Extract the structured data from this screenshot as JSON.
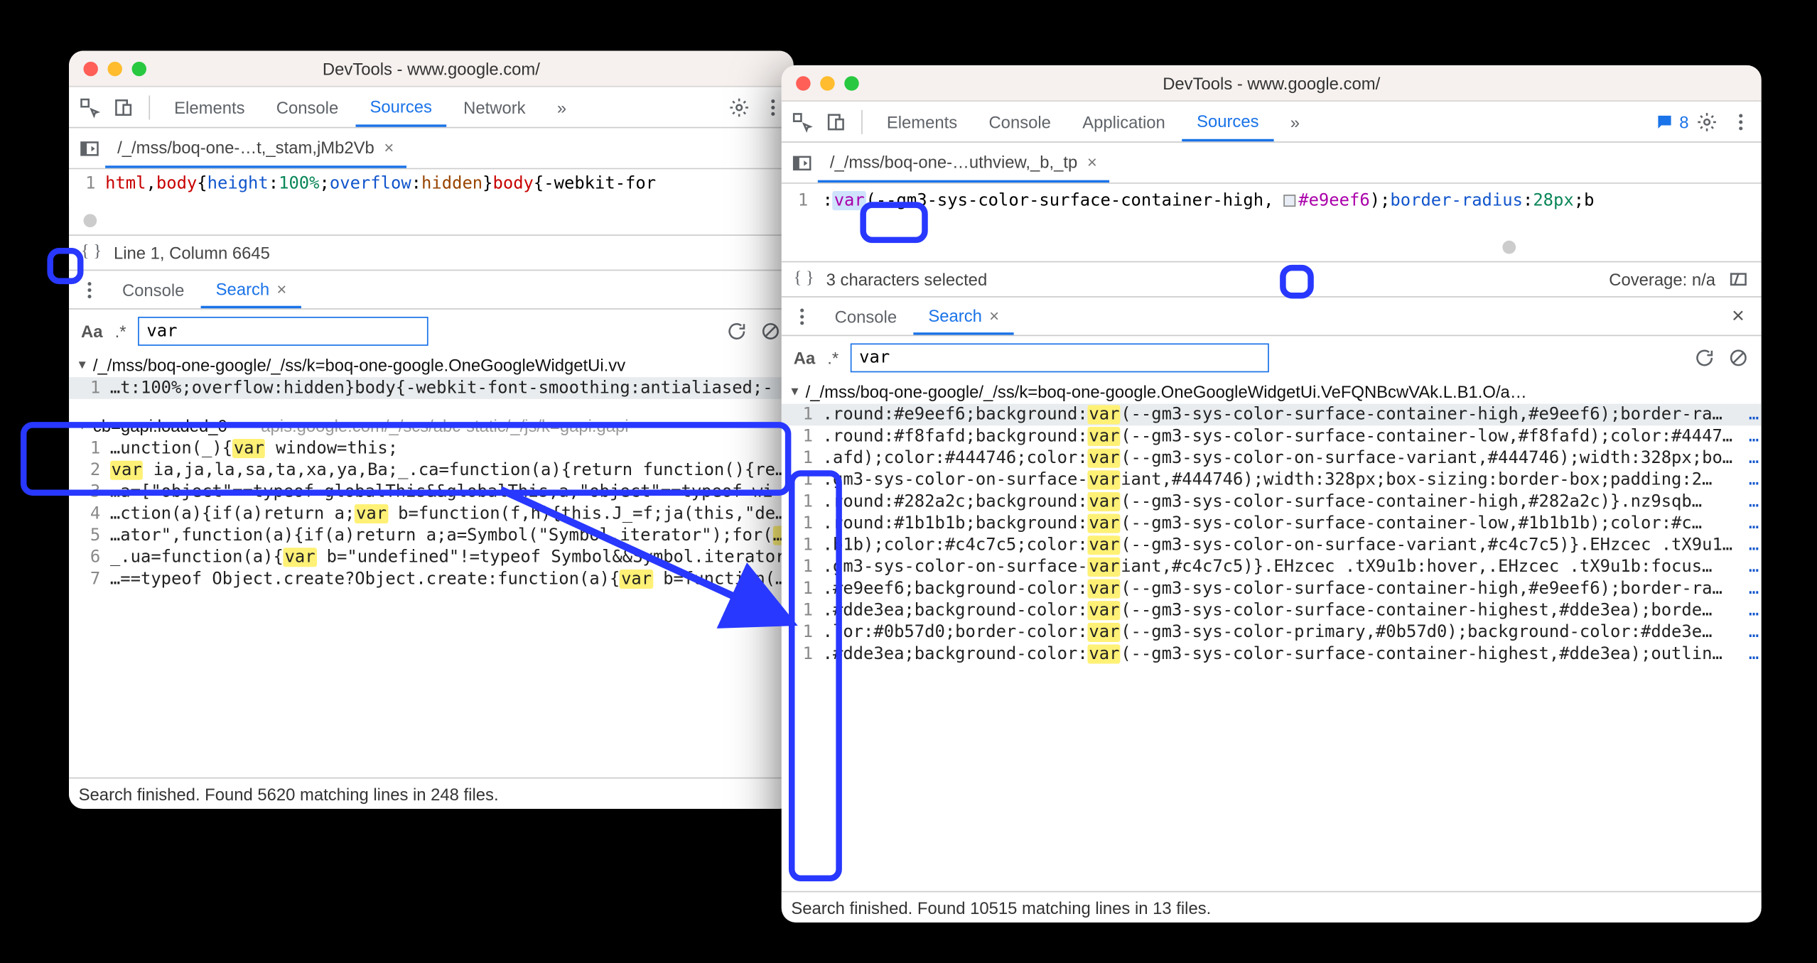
{
  "left": {
    "title": "DevTools - www.google.com/",
    "tabs": {
      "elements": "Elements",
      "console": "Console",
      "sources": "Sources",
      "network": "Network",
      "more": "»"
    },
    "file_tab": "/_/mss/boq-one-…t,_stam,jMb2Vb",
    "code": {
      "lineno": "1",
      "seg1a": "html",
      "seg1b": ",",
      "seg1c": "body",
      "seg2a": "{",
      "seg2b": "height",
      "seg2c": ":",
      "seg2d": "100%",
      "seg2e": ";",
      "seg3a": "overflow",
      "seg3b": ":",
      "seg3c": "hidden",
      "seg4": "}",
      "seg5a": "body",
      "seg5b": "{-webkit-for"
    },
    "status": "Line 1, Column 6645",
    "drawer": {
      "console": "Console",
      "search": "Search"
    },
    "search_value": "var",
    "groups": [
      {
        "header": "/_/mss/boq-one-google/_/ss/k=boq-one-google.OneGoogleWidgetUi.vv",
        "rows": [
          {
            "n": "1",
            "pre": "…t:100%;overflow:hidden}body{-webkit-font-smoothing:antialiased;-",
            "hl": "",
            "post": "",
            "selected": true
          }
        ]
      },
      {
        "header": "cb=gapi.loaded_0",
        "header_dim": "— apis.google.com/_/scs/abc-static/_/js/k=gapi.gapi",
        "rows": [
          {
            "n": "1",
            "pre": "…unction(_){",
            "hl": "var",
            "post": " window=this;"
          },
          {
            "n": "2",
            "pre": "",
            "hl": "var",
            "post": " ia,ja,la,sa,ta,xa,ya,Ba;_.ca=function(a){return function(){return _.ba"
          },
          {
            "n": "3",
            "pre": "…a=[\"object\"==typeof globalThis&&globalThis,a,\"object\"==typeof wi",
            "hl": "",
            "post": ""
          },
          {
            "n": "4",
            "pre": "…ction(a){if(a)return a;",
            "hl": "var",
            "post": " b=function(f,h){this.J_=f;ja(this,\"description\""
          },
          {
            "n": "5",
            "pre": "…ator\",function(a){if(a)return a;a=Symbol(\"Symbol.iterator\");for(",
            "hl": "var",
            "post": " b="
          },
          {
            "n": "6",
            "pre": "_.ua=function(a){",
            "hl": "var",
            "post": " b=\"undefined\"!=typeof Symbol&&Symbol.iterator"
          },
          {
            "n": "7",
            "pre": "…==typeof Object.create?Object.create:function(a){",
            "hl": "var",
            "post": " b=function(){}"
          }
        ]
      }
    ],
    "footer": "Search finished.  Found 5620 matching lines in 248 files."
  },
  "right": {
    "title": "DevTools - www.google.com/",
    "tabs": {
      "elements": "Elements",
      "console": "Console",
      "application": "Application",
      "sources": "Sources",
      "more": "»"
    },
    "badge_count": "8",
    "file_tab": "/_/mss/boq-one-…uthview,_b,_tp",
    "code": {
      "lineno": "1",
      "seg1": ":",
      "seg_var": "var",
      "seg_paren": "(",
      "seg2": "--gm3-sys-color-surface-container-high",
      "seg3": ", ",
      "seg_hex": "#e9eef6",
      "seg4": ");",
      "seg5a": "border-radius",
      "seg5b": ":",
      "seg5c": "28px",
      "seg6": ";b"
    },
    "status_left": "3 characters selected",
    "status_right": "Coverage: n/a",
    "drawer": {
      "console": "Console",
      "search": "Search"
    },
    "search_value": "var",
    "group_header": "/_/mss/boq-one-google/_/ss/k=boq-one-google.OneGoogleWidgetUi.VeFQNBcwVAk.L.B1.O/a…",
    "rows": [
      {
        "pre": ".round:#e9eef6;background:",
        "hl": "var",
        "post": "(--gm3-sys-color-surface-container-high,#e9eef6);border-ra…",
        "selected": true
      },
      {
        "pre": ".round:#f8fafd;background:",
        "hl": "var",
        "post": "(--gm3-sys-color-surface-container-low,#f8fafd);color:#4447…"
      },
      {
        "pre": ".afd);color:#444746;color:",
        "hl": "var",
        "post": "(--gm3-sys-color-on-surface-variant,#444746);width:328px;bo…"
      },
      {
        "pre": ".gm3-sys-color-on-surface-",
        "hl": "var",
        "post": "iant,#444746);width:328px;box-sizing:border-box;padding:2…"
      },
      {
        "pre": ".round:#282a2c;background:",
        "hl": "var",
        "post": "(--gm3-sys-color-surface-container-high,#282a2c)}.nz9sqb…"
      },
      {
        "pre": ".round:#1b1b1b;background:",
        "hl": "var",
        "post": "(--gm3-sys-color-surface-container-low,#1b1b1b);color:#c…"
      },
      {
        "pre": ".b1b);color:#c4c7c5;color:",
        "hl": "var",
        "post": "(--gm3-sys-color-on-surface-variant,#c4c7c5)}.EHzcec .tX9u1…"
      },
      {
        "pre": ".gm3-sys-color-on-surface-",
        "hl": "var",
        "post": "iant,#c4c7c5)}.EHzcec .tX9u1b:hover,.EHzcec .tX9u1b:focus…"
      },
      {
        "pre": ".#e9eef6;background-color:",
        "hl": "var",
        "post": "(--gm3-sys-color-surface-container-high,#e9eef6);border-ra…"
      },
      {
        "pre": ".#dde3ea;background-color:",
        "hl": "var",
        "post": "(--gm3-sys-color-surface-container-highest,#dde3ea);borde…"
      },
      {
        "pre": ".lor:#0b57d0;border-color:",
        "hl": "var",
        "post": "(--gm3-sys-color-primary,#0b57d0);background-color:#dde3e…"
      },
      {
        "pre": ".#dde3ea;background-color:",
        "hl": "var",
        "post": "(--gm3-sys-color-surface-container-highest,#dde3ea);outlin…"
      }
    ],
    "footer": "Search finished.  Found 10515 matching lines in 13 files."
  }
}
